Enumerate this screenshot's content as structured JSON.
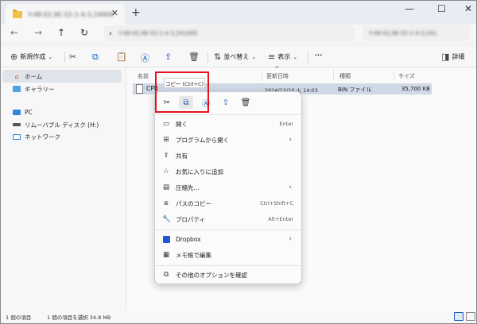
{
  "window": {
    "tab_title": "Y-48-02,9E-52-1-4-3,24909",
    "tab_close": "✕",
    "tab_add": "+",
    "minimize": "—",
    "maximize": "☐",
    "close": "✕"
  },
  "address": {
    "path": "Y-48-02,9E-52-1-4-3,241009",
    "search": "Y-48-02,9E-52-1-4-3,241"
  },
  "commandbar": {
    "new_label": "新規作成",
    "sort_label": "並べ替え",
    "view_label": "表示",
    "more_label": "···",
    "details_label": "詳細"
  },
  "sidebar": {
    "items": [
      {
        "label": "ホーム",
        "icon": "home-icon"
      },
      {
        "label": "ギャラリー",
        "icon": "gallery-icon"
      },
      {
        "label": "PC",
        "icon": "pc-icon"
      },
      {
        "label": "リムーバブル ディスク (H:)",
        "icon": "drive-icon"
      },
      {
        "label": "ネットワーク",
        "icon": "network-icon"
      }
    ]
  },
  "columns": {
    "name": "名前",
    "date": "更新日時",
    "type": "種類",
    "size": "サイズ"
  },
  "file": {
    "name": "CPR",
    "date": "2024/12/10 火 14:03",
    "type": "BIN ファイル",
    "size": "35,700 KB"
  },
  "tooltip": "コピー (Ctrl+C)",
  "context_menu": {
    "items": [
      {
        "label": "開く",
        "shortcut": "Enter"
      },
      {
        "label": "プログラムから開く"
      },
      {
        "label": "共有"
      },
      {
        "label": "お気に入りに追加"
      },
      {
        "label": "圧縮先..."
      },
      {
        "label": "パスのコピー",
        "shortcut": "Ctrl+Shift+C"
      },
      {
        "label": "プロパティ",
        "shortcut": "Alt+Enter"
      },
      {
        "label": "Dropbox"
      },
      {
        "label": "メモ帳で編集"
      },
      {
        "label": "その他のオプションを確認"
      }
    ]
  },
  "status": {
    "count": "1 個の項目",
    "selected": "1 個の項目を選択 34.8 MB"
  },
  "colors": {
    "highlight": "#e3141b",
    "selection": "#cfd8e6"
  }
}
